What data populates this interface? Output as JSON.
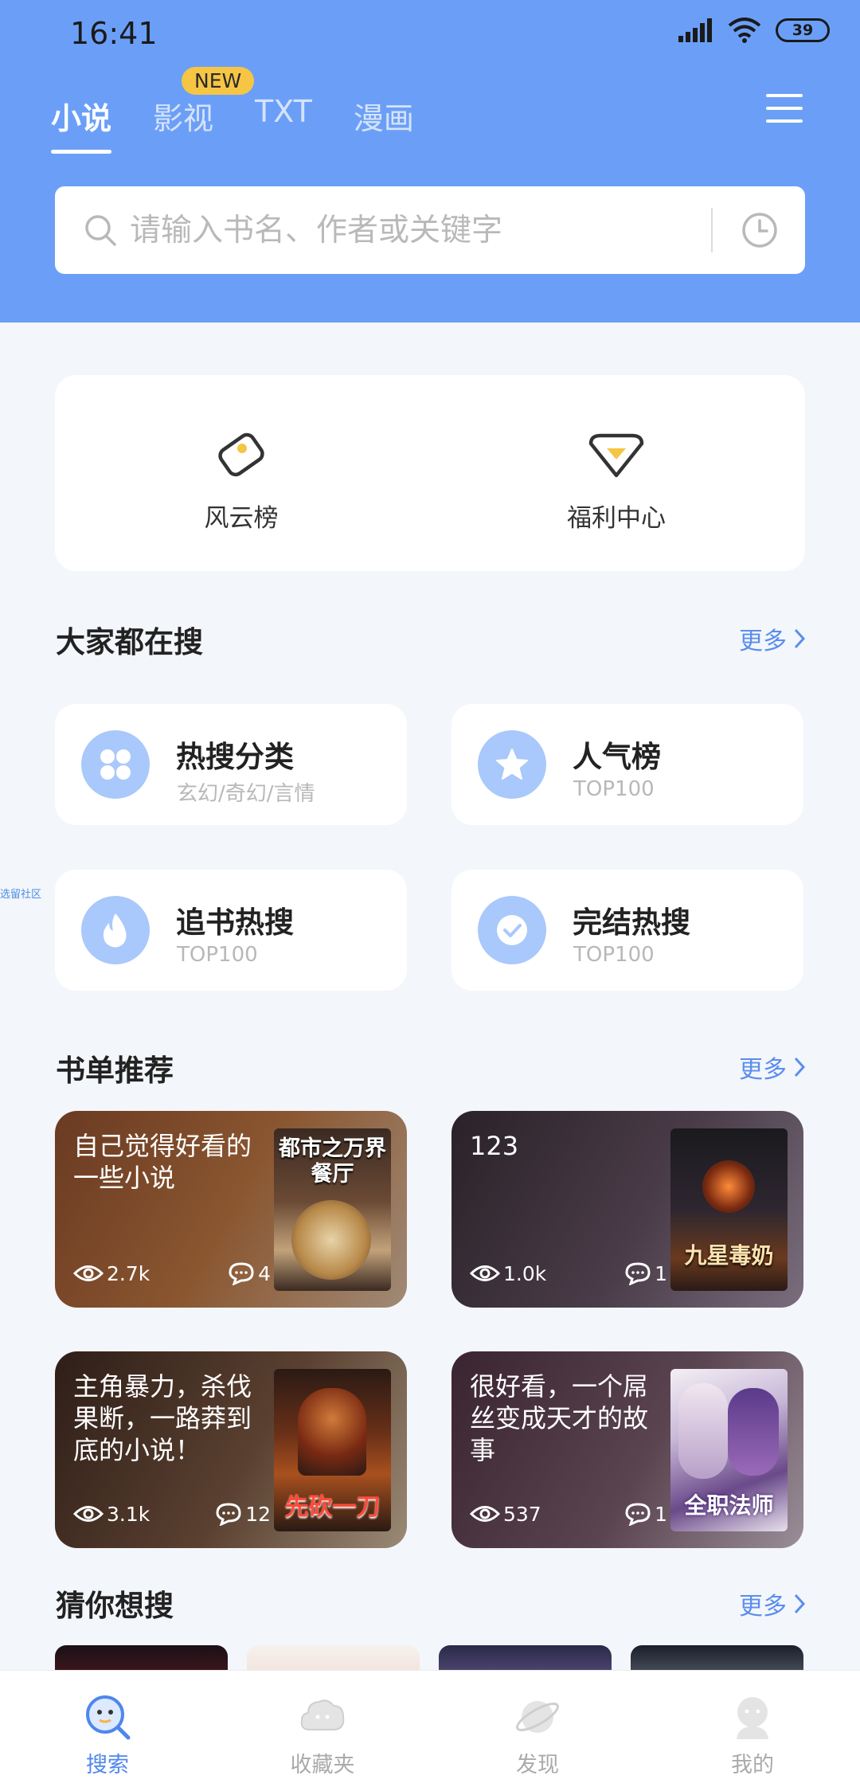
{
  "status_bar": {
    "time": "16:41",
    "battery": "39"
  },
  "tabs": [
    {
      "label": "小说",
      "active": true
    },
    {
      "label": "影视",
      "active": false
    },
    {
      "label": "TXT",
      "active": false
    },
    {
      "label": "漫画",
      "active": false
    }
  ],
  "new_badge": "NEW",
  "search": {
    "placeholder": "请输入书名、作者或关键字"
  },
  "quick_links": [
    {
      "label": "风云榜",
      "icon": "tag-icon"
    },
    {
      "label": "福利中心",
      "icon": "gem-icon"
    }
  ],
  "popular": {
    "title": "大家都在搜",
    "more": "更多",
    "items": [
      {
        "title": "热搜分类",
        "subtitle": "玄幻/奇幻/言情",
        "icon": "grid-icon"
      },
      {
        "title": "人气榜",
        "subtitle": "TOP100",
        "icon": "star-icon"
      },
      {
        "title": "追书热搜",
        "subtitle": "TOP100",
        "icon": "flame-icon"
      },
      {
        "title": "完结热搜",
        "subtitle": "TOP100",
        "icon": "check-icon"
      }
    ]
  },
  "side_text": "选留社区",
  "booklists": {
    "title": "书单推荐",
    "more": "更多",
    "items": [
      {
        "title": "自己觉得好看的一些小说",
        "views": "2.7k",
        "comments": "4",
        "cover_text": "都市之万界餐厅",
        "bg": "#7a4a2c"
      },
      {
        "title": "123",
        "views": "1.0k",
        "comments": "1",
        "cover_text": "九星毒奶",
        "bg": "#3d3540"
      },
      {
        "title": "主角暴力，杀伐果断，一路莽到底的小说！",
        "views": "3.1k",
        "comments": "12",
        "cover_text": "先砍一刀",
        "bg": "#3a2a22"
      },
      {
        "title": "很好看，一个屌丝变成天才的故事",
        "views": "537",
        "comments": "1",
        "cover_text": "全职法师",
        "bg": "#43313a"
      }
    ]
  },
  "guess": {
    "title": "猜你想搜",
    "more": "更多"
  },
  "bottom_nav": [
    {
      "label": "搜索",
      "icon": "search-face-icon",
      "active": true
    },
    {
      "label": "收藏夹",
      "icon": "bookmark-cloud-icon",
      "active": false
    },
    {
      "label": "发现",
      "icon": "planet-icon",
      "active": false
    },
    {
      "label": "我的",
      "icon": "profile-icon",
      "active": false
    }
  ]
}
